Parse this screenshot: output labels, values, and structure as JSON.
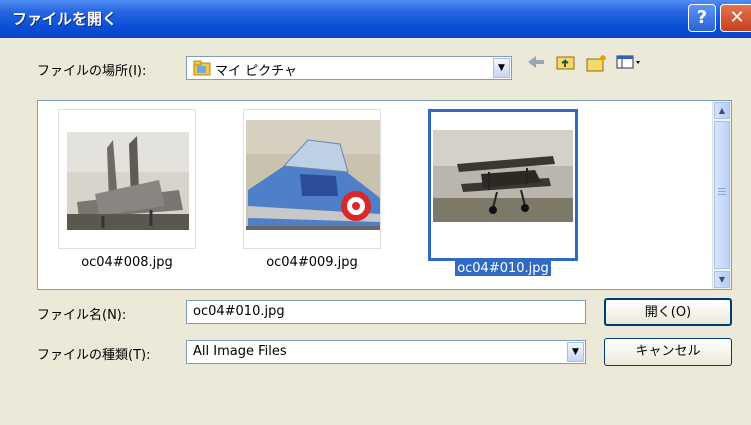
{
  "dialog": {
    "title": "ファイルを開く",
    "help_glyph": "?",
    "close_glyph": "✕"
  },
  "look_in": {
    "label": "ファイルの場所(I):",
    "value": "マイ ピクチャ"
  },
  "toolbar": {
    "icons": [
      "back-icon",
      "up-folder-icon",
      "new-folder-icon",
      "view-menu-icon"
    ]
  },
  "files": [
    {
      "name": "oc04#008.jpg",
      "selected": false
    },
    {
      "name": "oc04#009.jpg",
      "selected": false
    },
    {
      "name": "oc04#010.jpg",
      "selected": true
    }
  ],
  "file_name": {
    "label": "ファイル名(N):",
    "value": "oc04#010.jpg"
  },
  "file_type": {
    "label": "ファイルの種類(T):",
    "value": "All Image Files"
  },
  "buttons": {
    "open": "開く(O)",
    "cancel": "キャンセル"
  },
  "colors": {
    "titlebar": "#0a4fd8",
    "selection": "#316ac5",
    "dialog_bg": "#ece9d8"
  }
}
